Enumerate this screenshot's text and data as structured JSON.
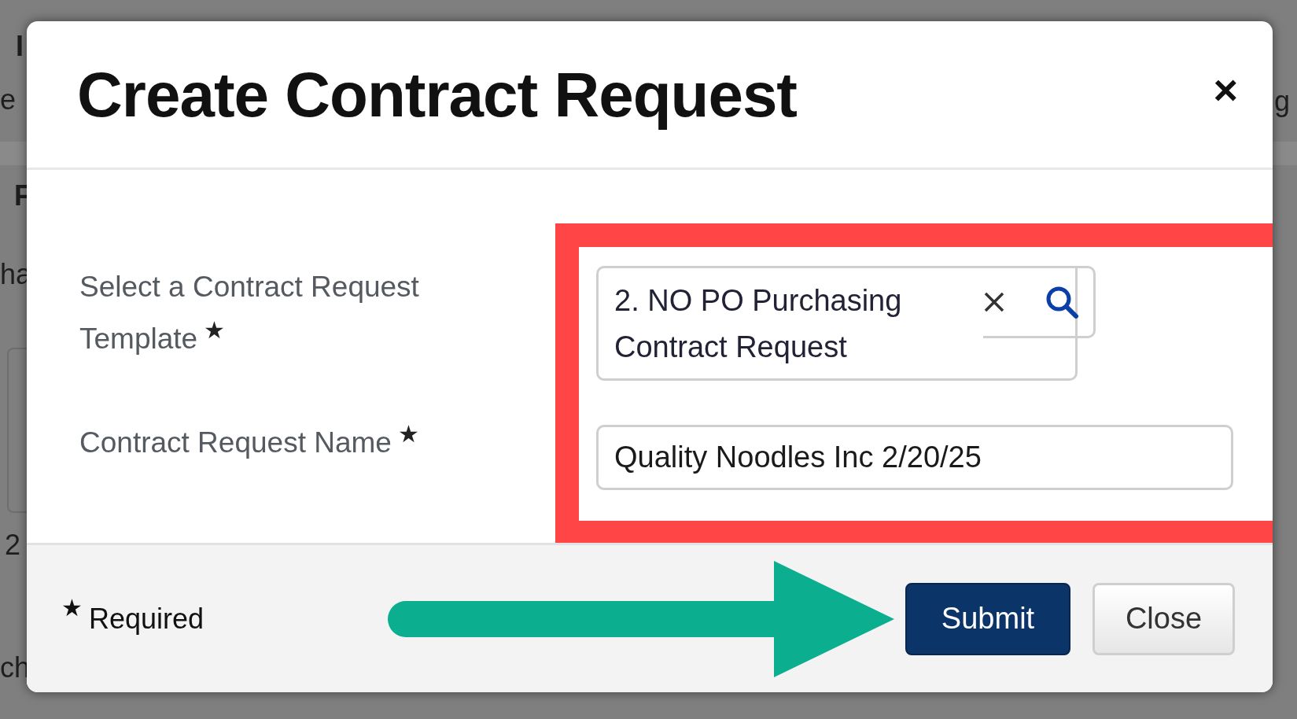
{
  "background": {
    "left_fragments": [
      {
        "text": "I",
        "kind": "heading"
      },
      {
        "text": "e",
        "kind": "text"
      },
      {
        "text": "F",
        "kind": "heading"
      },
      {
        "text": "ha",
        "kind": "text"
      },
      {
        "text": "2",
        "kind": "text"
      },
      {
        "text": "ch",
        "kind": "text"
      }
    ],
    "right_fragments": [
      {
        "text": "g"
      }
    ]
  },
  "modal": {
    "title": "Create Contract Request",
    "close_symbol": "×",
    "fields": [
      {
        "kind": "lookup",
        "label": "Select a Contract Request Template",
        "star": "★",
        "value": "2. NO PO Purchasing Contract Request"
      },
      {
        "kind": "text",
        "label": "Contract Request Name",
        "star": "★",
        "value": "Quality Noodles Inc 2/20/25"
      }
    ],
    "footer": {
      "star": "★",
      "legend": "Required",
      "buttons": [
        {
          "label": "Submit",
          "kind": "primary"
        },
        {
          "label": "Close",
          "kind": "secondary"
        }
      ]
    }
  }
}
